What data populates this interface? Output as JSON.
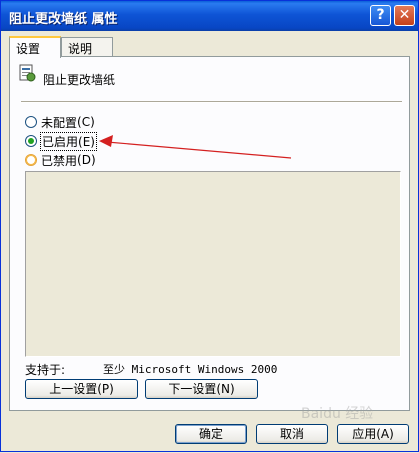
{
  "window": {
    "title": "阻止更改墙纸 属性"
  },
  "titlebar": {
    "help_glyph": "?",
    "close_glyph": "✕"
  },
  "tabs": [
    {
      "label": "设置"
    },
    {
      "label": "说明"
    }
  ],
  "policy": {
    "name": "阻止更改墙纸",
    "icon": "policy-setting-icon"
  },
  "options": [
    {
      "label": "未配置",
      "hotkey": "(C)",
      "selected": false
    },
    {
      "label": "已启用",
      "hotkey": "(E)",
      "selected": true
    },
    {
      "label": "已禁用",
      "hotkey": "(D)",
      "selected": false
    }
  ],
  "supported": {
    "label": "支持于:",
    "value": "至少 Microsoft Windows 2000"
  },
  "nav": {
    "prev": "上一设置(P)",
    "next": "下一设置(N)"
  },
  "footer": {
    "ok": "确定",
    "cancel": "取消",
    "apply": "应用(A)"
  },
  "annotation": {
    "arrow_color": "#d42020"
  },
  "watermark": {
    "text": "Baidu 经验"
  }
}
